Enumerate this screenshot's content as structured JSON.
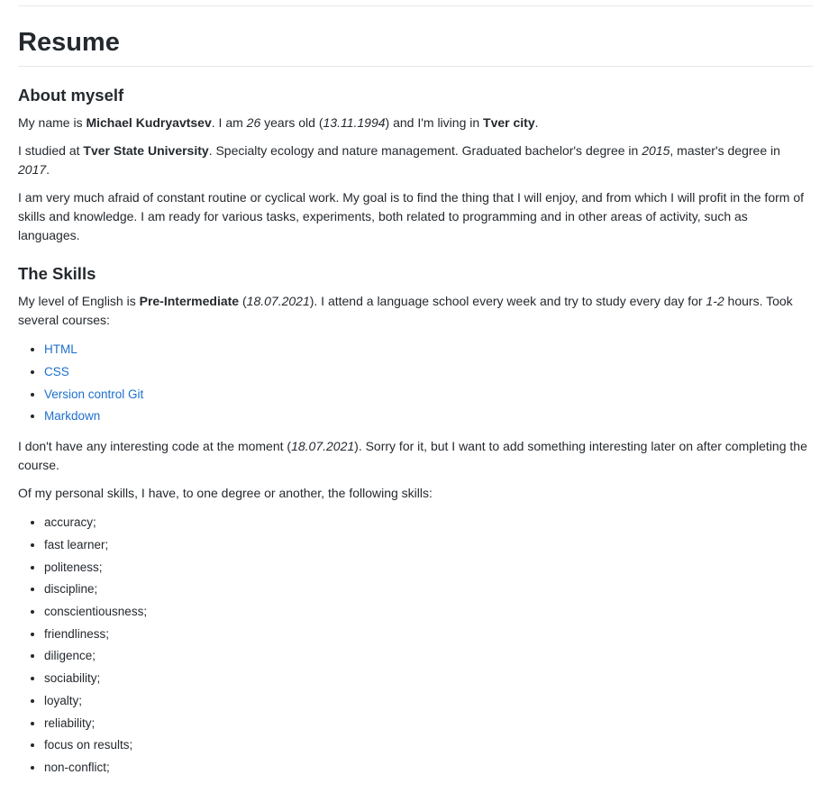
{
  "title": "Resume",
  "about": {
    "heading": "About myself",
    "p1": {
      "t1": "My name is ",
      "name": "Michael Kudryavtsev",
      "t2": ". I am ",
      "age": "26",
      "t3": " years old (",
      "birth": "13.11.1994",
      "t4": ") and I'm living in ",
      "city": "Tver city",
      "t5": "."
    },
    "p2": {
      "t1": "I studied at ",
      "university": "Tver State University",
      "t2": ". Specialty ecology and nature management. Graduated bachelor's degree in ",
      "bachelor_year": "2015",
      "t3": ", master's degree in ",
      "master_year": "2017",
      "t4": "."
    },
    "p3": "I am very much afraid of constant routine or cyclical work. My goal is to find the thing that I will enjoy, and from which I will profit in the form of skills and knowledge. I am ready for various tasks, experiments, both related to programming and in other areas of activity, such as languages."
  },
  "skills": {
    "heading": "The Skills",
    "p1": {
      "t1": "My level of English is ",
      "level": "Pre-Intermediate",
      "t2": " (",
      "date": "18.07.2021",
      "t3": "). I attend a language school every week and try to study every day for ",
      "hours": "1-2",
      "t4": " hours. Took several courses:"
    },
    "courses": [
      "HTML",
      "CSS",
      "Version control Git",
      "Markdown"
    ],
    "p2": {
      "t1": "I don't have any interesting code at the moment (",
      "date": "18.07.2021",
      "t2": "). Sorry for it, but I want to add something interesting later on after completing the course."
    },
    "p3": "Of my personal skills, I have, to one degree or another, the following skills:",
    "personal": [
      "accuracy;",
      "fast learner;",
      "politeness;",
      "discipline;",
      "conscientiousness;",
      "friendliness;",
      "diligence;",
      "sociability;",
      "loyalty;",
      "reliability;",
      "focus on results;",
      "non-conflict;"
    ]
  },
  "colors": {
    "link": "#1d6fce",
    "text": "#24292e",
    "rule": "#e4e7ea"
  }
}
